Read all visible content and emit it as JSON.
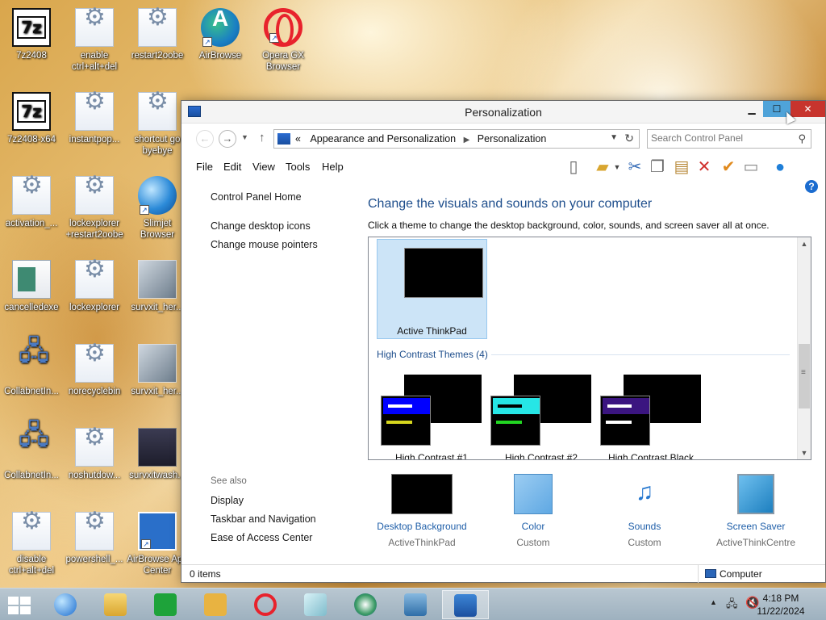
{
  "desktop": {
    "icons": [
      {
        "label": "7z2408",
        "icon": "7zip-icon"
      },
      {
        "label": "enable ctrl+alt+del",
        "icon": "script-icon"
      },
      {
        "label": "restart2oobe",
        "icon": "script-icon"
      },
      {
        "label": "AirBrowse",
        "icon": "airbrowse-icon"
      },
      {
        "label": "Opera GX Browser",
        "icon": "opera-icon"
      },
      {
        "label": "7z2408-x64",
        "icon": "7zip-icon"
      },
      {
        "label": "instantpop...",
        "icon": "script-icon"
      },
      {
        "label": "shortcut go byebye",
        "icon": "script-icon"
      },
      {
        "label": "activation_...",
        "icon": "script-icon"
      },
      {
        "label": "lockexplorer +restart2oobe",
        "icon": "script-icon"
      },
      {
        "label": "Slimjet Browser",
        "icon": "slimjet-icon"
      },
      {
        "label": "cancelledexe",
        "icon": "document-icon"
      },
      {
        "label": "lockexplorer",
        "icon": "script-icon"
      },
      {
        "label": "survxit_her...",
        "icon": "image-icon"
      },
      {
        "label": "CollabnetIn...",
        "icon": "network-icon"
      },
      {
        "label": "norecyclebin",
        "icon": "script-icon"
      },
      {
        "label": "survxit_her...",
        "icon": "image-icon"
      },
      {
        "label": "CollabnetIn...",
        "icon": "network-icon"
      },
      {
        "label": "noshutdow...",
        "icon": "script-icon"
      },
      {
        "label": "survxitwash...",
        "icon": "image-icon"
      },
      {
        "label": "disable ctrl+alt+del",
        "icon": "script-icon"
      },
      {
        "label": "powershell_...",
        "icon": "script-icon"
      },
      {
        "label": "AirBrowse App Center",
        "icon": "app-center-icon"
      }
    ]
  },
  "window": {
    "title": "Personalization",
    "breadcrumb": [
      "Appearance and Personalization",
      "Personalization"
    ],
    "breadcrumb_prefix": "«",
    "search_placeholder": "Search Control Panel",
    "menu": [
      "File",
      "Edit",
      "View",
      "Tools",
      "Help"
    ],
    "left_links": [
      "Control Panel Home",
      "Change desktop icons",
      "Change mouse pointers"
    ],
    "see_also_label": "See also",
    "see_also_links": [
      "Display",
      "Taskbar and Navigation",
      "Ease of Access Center"
    ],
    "heading": "Change the visuals and sounds on your computer",
    "subtext": "Click a theme to change the desktop background, color, sounds, and screen saver all at once.",
    "selected_theme": "Active ThinkPad",
    "high_contrast_group": "High Contrast Themes (4)",
    "high_contrast_themes": [
      {
        "name": "High Contrast #1",
        "accent": "#0000ff",
        "bar": "#d6d61e"
      },
      {
        "name": "High Contrast #2",
        "accent": "#26e6e6",
        "bar": "#22d622"
      },
      {
        "name": "High Contrast Black",
        "accent": "#3b1580",
        "bar": "#ffffff"
      }
    ],
    "bottom_items": [
      {
        "name": "Desktop Background",
        "value": "ActiveThinkPad",
        "icon": "desktop-background-icon"
      },
      {
        "name": "Color",
        "value": "Custom",
        "icon": "color-icon"
      },
      {
        "name": "Sounds",
        "value": "Custom",
        "icon": "sounds-icon"
      },
      {
        "name": "Screen Saver",
        "value": "ActiveThinkCentre",
        "icon": "screen-saver-icon"
      }
    ],
    "status_items": "0 items",
    "status_zone": "Computer"
  },
  "taskbar": {
    "time": "4:18 PM",
    "date": "11/22/2024"
  },
  "colors": {
    "heading_blue": "#1e4e8c",
    "link_blue": "#1e5ea8",
    "selected_bg": "#cce4f7",
    "close_red": "#c7342d",
    "maximize_blue": "#4fa3d9"
  }
}
